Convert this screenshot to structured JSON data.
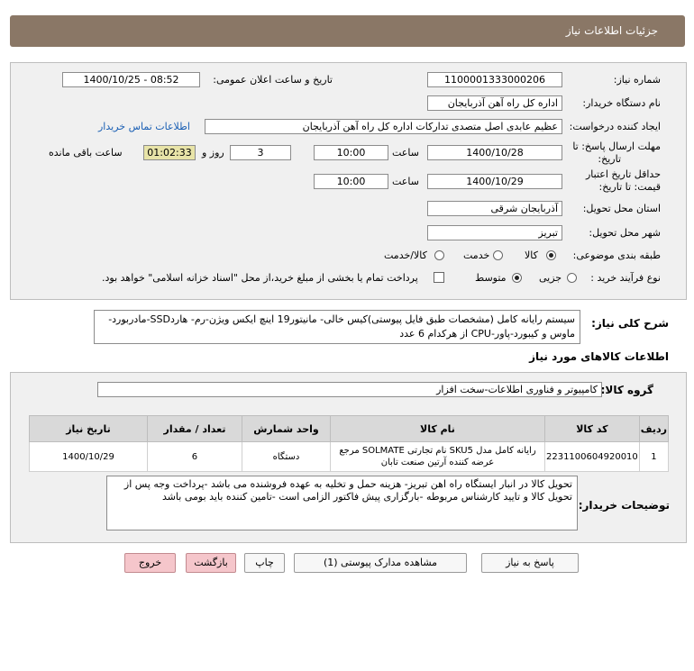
{
  "header": {
    "title": "جزئیات اطلاعات نیاز"
  },
  "form": {
    "need_number_label": "شماره نیاز:",
    "need_number": "1100001333000206",
    "announce_label": "تاریخ و ساعت اعلان عمومی:",
    "announce_value": "1400/10/25 - 08:52",
    "buyer_org_label": "نام دستگاه خریدار:",
    "buyer_org": "اداره کل راه آهن آذربایجان",
    "creator_label": "ایجاد کننده درخواست:",
    "creator": "عظیم عابدی اصل متصدی تدارکات اداره کل راه آهن آذربایجان",
    "contact_link": "اطلاعات تماس خریدار",
    "reply_deadline_label_1": "مهلت ارسال پاسخ: تا",
    "reply_deadline_label_2": "تاریخ:",
    "reply_date": "1400/10/28",
    "time_label": "ساعت",
    "reply_time": "10:00",
    "days": "3",
    "days_label": "روز و",
    "countdown": "01:02:33",
    "remaining_label": "ساعت باقی مانده",
    "validity_label_1": "حداقل تاریخ اعتبار",
    "validity_label_2": "قیمت: تا تاریخ:",
    "validity_date": "1400/10/29",
    "validity_time": "10:00",
    "province_label": "استان محل تحویل:",
    "province": "آذربایجان شرقی",
    "city_label": "شهر محل تحویل:",
    "city": "تبریز",
    "category_label": "طبقه بندی موضوعی:",
    "category_options": [
      "کالا",
      "خدمت",
      "کالا/خدمت"
    ],
    "category_selected": 0,
    "process_label": "نوع فرآیند خرید :",
    "process_options": [
      "جزیی",
      "متوسط"
    ],
    "process_selected": 1,
    "payment_text": "پرداخت تمام یا بخشی از مبلغ خرید،از محل \"اسناد خزانه اسلامی\" خواهد بود."
  },
  "description": {
    "label": "شرح کلی نیاز:",
    "text": "سیستم رایانه کامل (مشخصات طبق فایل پیوستی)کیس خالی- مانیتور19 اینچ ایکس ویژن-رم- هاردSSD-مادربورد-ماوس و کیبورد-پاور-CPU از هرکدام 6 عدد"
  },
  "items_section": {
    "title": "اطلاعات کالاهای مورد نیاز",
    "group_label": "گروه کالا:",
    "group_value": "کامپیوتر و فناوری اطلاعات-سخت افزار",
    "columns": [
      "ردیف",
      "کد کالا",
      "نام کالا",
      "واحد شمارش",
      "تعداد / مقدار",
      "تاریخ نیاز"
    ],
    "rows": [
      {
        "row": "1",
        "code": "2231100604920010",
        "name": "رایانه کامل مدل SKU5 نام تجارتی SOLMATE مرجع عرضه کننده آرتین صنعت تابان",
        "unit": "دستگاه",
        "qty": "6",
        "date": "1400/10/29"
      }
    ],
    "notes_label": "توضیحات خریدار:",
    "notes": "تحویل کالا در انبار ایستگاه راه اهن تبریز- هزینه حمل و تخلیه به عهده  فروشنده می باشد -پرداخت وجه پس از تحویل کالا و تایید کارشناس مربوطه -بارگزاری پیش فاکتور الزامی است -تامین کننده باید بومی باشد"
  },
  "buttons": {
    "reply": "پاسخ به نیاز",
    "attachments": "مشاهده مدارک پیوستی (1)",
    "print": "چاپ",
    "back": "بازگشت",
    "exit": "خروج"
  }
}
